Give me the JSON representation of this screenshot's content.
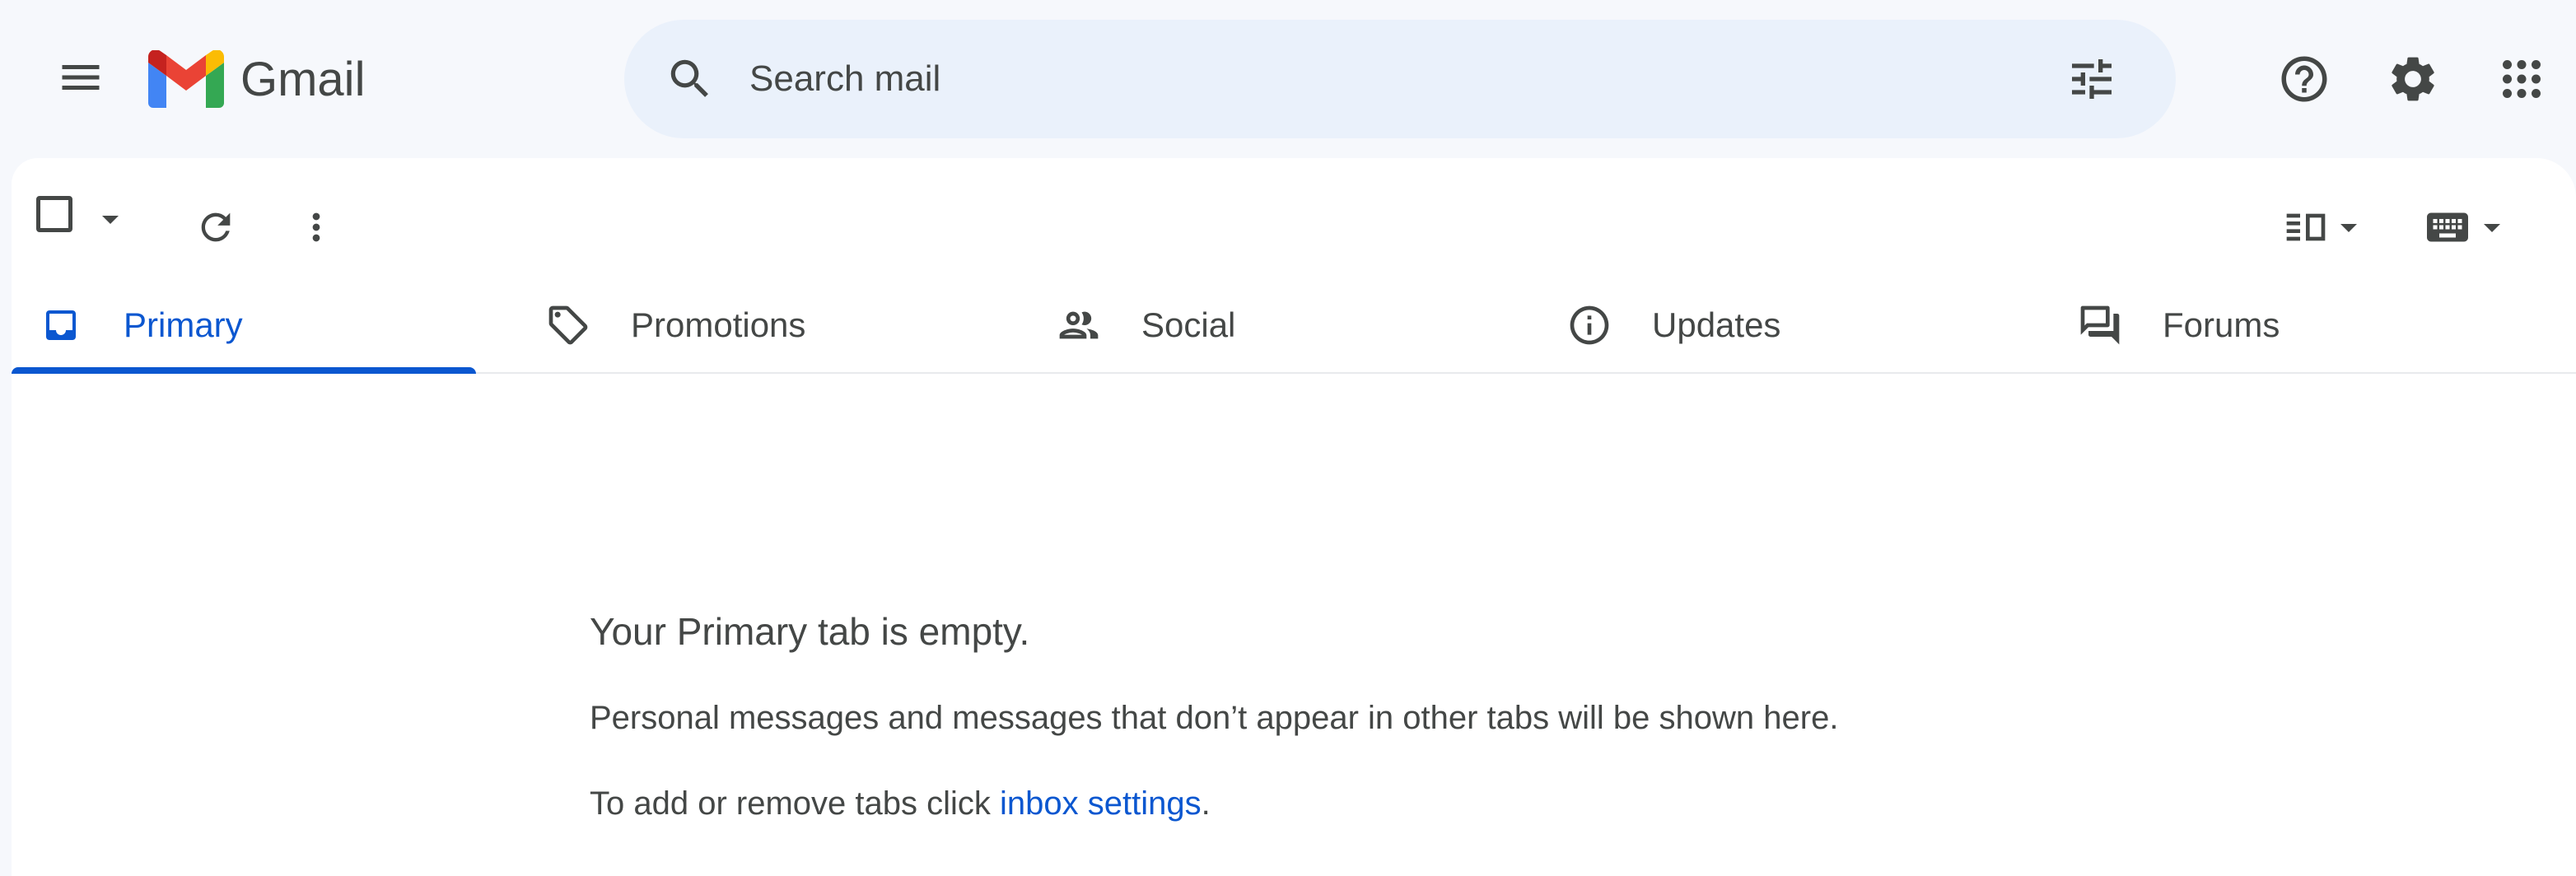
{
  "app": {
    "name": "Gmail"
  },
  "search": {
    "placeholder": "Search mail"
  },
  "tabs": [
    {
      "label": "Primary",
      "icon": "inbox-icon",
      "active": true
    },
    {
      "label": "Promotions",
      "icon": "tag-icon",
      "active": false
    },
    {
      "label": "Social",
      "icon": "people-icon",
      "active": false
    },
    {
      "label": "Updates",
      "icon": "info-icon",
      "active": false
    },
    {
      "label": "Forums",
      "icon": "forum-icon",
      "active": false
    }
  ],
  "empty_state": {
    "title": "Your Primary tab is empty.",
    "description": "Personal messages and messages that don’t appear in other tabs will be shown here.",
    "settings_prefix": "To add or remove tabs click ",
    "settings_link": "inbox settings",
    "settings_suffix": "."
  },
  "colors": {
    "accent": "#0b57d0",
    "background": "#f6f8fc",
    "search_background": "#eaf1fb",
    "text": "#444746"
  }
}
